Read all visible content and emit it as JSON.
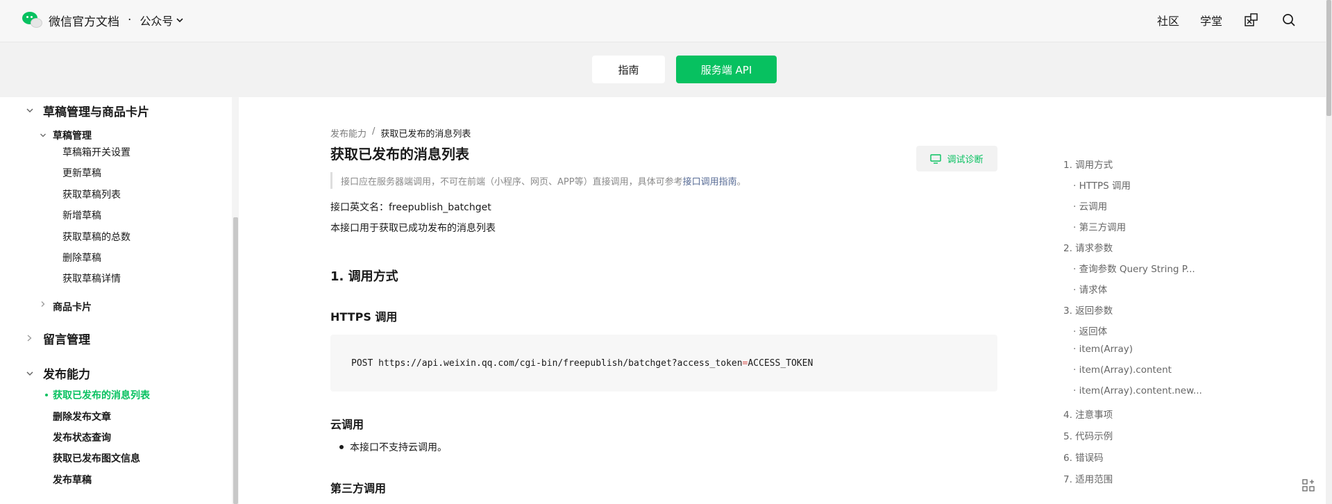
{
  "header": {
    "brand": "微信官方文档",
    "separator": "·",
    "channel": "公众号",
    "nav_links": [
      "社区",
      "学堂"
    ],
    "icons": [
      "sandbox-icon",
      "search-icon"
    ]
  },
  "tabs": {
    "guide": "指南",
    "api": "服务端 API"
  },
  "sidebar": {
    "draft_group": "草稿管理与商品卡片",
    "draft_sub": "草稿管理",
    "draft_items": [
      "草稿箱开关设置",
      "更新草稿",
      "获取草稿列表",
      "新增草稿",
      "获取草稿的总数",
      "删除草稿",
      "获取草稿详情"
    ],
    "product_card": "商品卡片",
    "comment_group": "留言管理",
    "publish_group": "发布能力",
    "publish_items": [
      "获取已发布的消息列表",
      "删除发布文章",
      "发布状态查询",
      "获取已发布图文信息",
      "发布草稿"
    ]
  },
  "main": {
    "breadcrumb_parent": "发布能力",
    "breadcrumb_sep": "/",
    "breadcrumb_current": "获取已发布的消息列表",
    "title": "获取已发布的消息列表",
    "debug_button": "调试诊断",
    "notice_text": "接口应在服务器端调用，不可在前端（小程序、网页、APP等）直接调用，具体可参考",
    "notice_link": "接口调用指南",
    "notice_end": "。",
    "api_name": "接口英文名：freepublish_batchget",
    "description": "本接口用于获取已成功发布的消息列表",
    "section1": "1. 调用方式",
    "https_heading": "HTTPS 调用",
    "code_prefix": "POST https://api.weixin.qq.com/cgi-bin/freepublish/batchget?access_token",
    "code_eq": "=",
    "code_suffix": "ACCESS_TOKEN",
    "cloud_heading": "云调用",
    "cloud_bullet": "本接口不支持云调用。",
    "third_heading": "第三方调用"
  },
  "toc": [
    "1. 调用方式",
    "· HTTPS 调用",
    "· 云调用",
    "· 第三方调用",
    "2. 请求参数",
    "· 查询参数 Query String P...",
    "· 请求体",
    "3. 返回参数",
    "· 返回体",
    "· item(Array)",
    "· item(Array).content",
    "· item(Array).content.new...",
    "4. 注意事项",
    "5. 代码示例",
    "6. 错误码",
    "7. 适用范围"
  ],
  "colors": {
    "brand_green": "#07c160",
    "link_blue": "#576b95",
    "code_highlight": "#d9534f"
  }
}
